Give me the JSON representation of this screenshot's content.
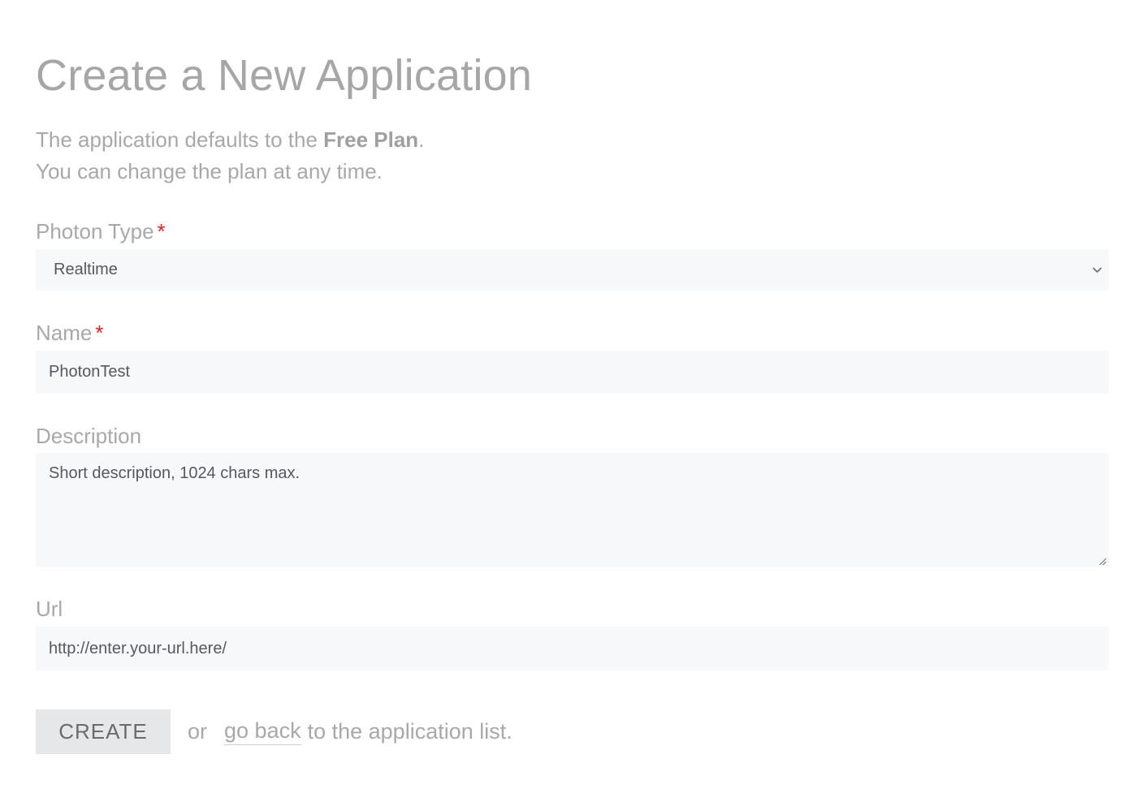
{
  "page": {
    "title": "Create a New Application",
    "intro_line1_prefix": "The application defaults to the ",
    "intro_line1_bold": "Free Plan",
    "intro_line1_suffix": ".",
    "intro_line2": "You can change the plan at any time."
  },
  "form": {
    "photon_type": {
      "label": "Photon Type",
      "required_mark": "*",
      "selected": "Realtime"
    },
    "name": {
      "label": "Name",
      "required_mark": "*",
      "value": "PhotonTest"
    },
    "description": {
      "label": "Description",
      "value": "Short description, 1024 chars max."
    },
    "url": {
      "label": "Url",
      "value": "http://enter.your-url.here/"
    }
  },
  "actions": {
    "create_label": "CREATE",
    "or_text": "or",
    "back_link": "go back",
    "back_suffix": "to the application list."
  },
  "colors": {
    "required": "#e0241c",
    "input_background": "#f7f8fa",
    "button_background": "#e6e7e8"
  },
  "icons": {
    "select_chevron": "chevron-down-icon",
    "textarea_resize": "resize-handle-icon"
  }
}
